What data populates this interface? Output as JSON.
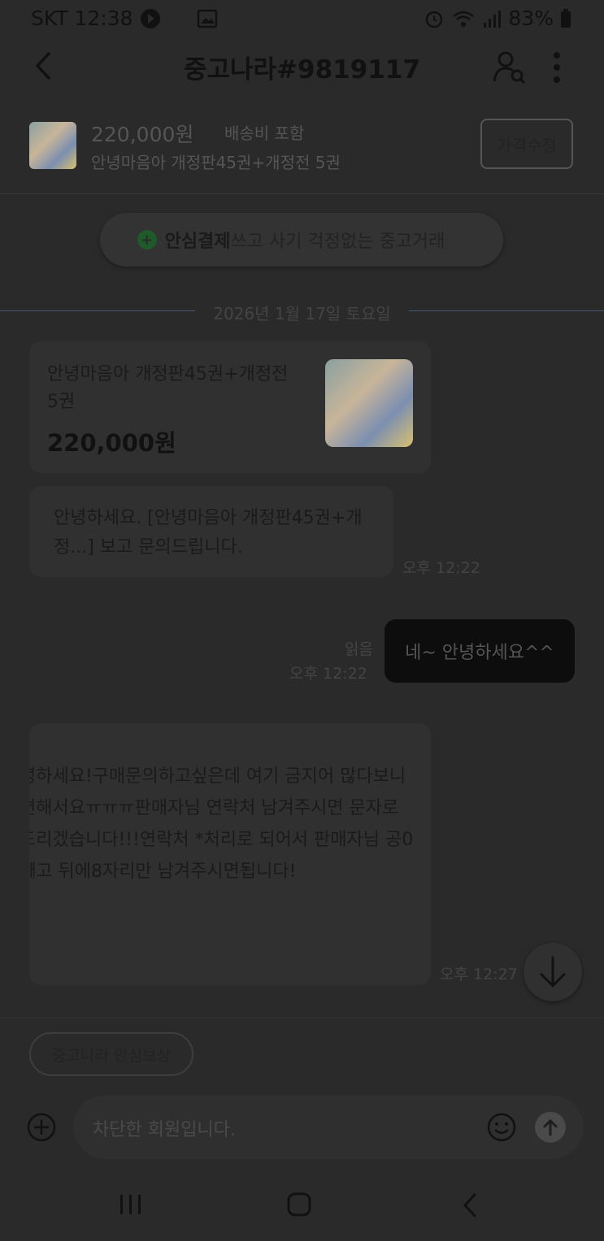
{
  "status_bar": {
    "carrier_time": "SKT 12:38",
    "battery": "83%"
  },
  "header": {
    "title": "중고나라#9819117"
  },
  "product_bar": {
    "price": "220,000원",
    "shipping": "배송비 포함",
    "title": "안녕마음아 개정판45권+개정전 5권",
    "edit_button": "가격수정"
  },
  "safe_pay": {
    "bold": "안심결제",
    "rest": "쓰고 사기 걱정없는 중고거래"
  },
  "date_divider": "2026년 1월 17일 토요일",
  "product_card": {
    "title": "안녕마음아 개정판45권+개정전 5권",
    "price": "220,000원"
  },
  "messages": [
    {
      "text": "안녕하세요. [안녕마음아 개정판45권+개정...] 보고 문의드립니다.",
      "time": "오후 12:22"
    },
    {
      "text": "네~ 안녕하세요^^",
      "read": "읽음",
      "time": "오후 12:22"
    },
    {
      "lines": [
        "녕하세요!구매문의하고싶은데 여기 금지어 많다보니",
        "편해서요ㅠㅠㅠ판매자님 연락처 남겨주시면 문자로",
        "드리겠습니다!!!연락처 *처리로 되어서 판매자님 공0",
        "빼고 뒤에8자리만 남겨주시면됩니다!"
      ],
      "time": "오후 12:27"
    }
  ],
  "footer": {
    "chip": "중고나라 안심보상",
    "input_placeholder": "차단한 회원입니다."
  }
}
